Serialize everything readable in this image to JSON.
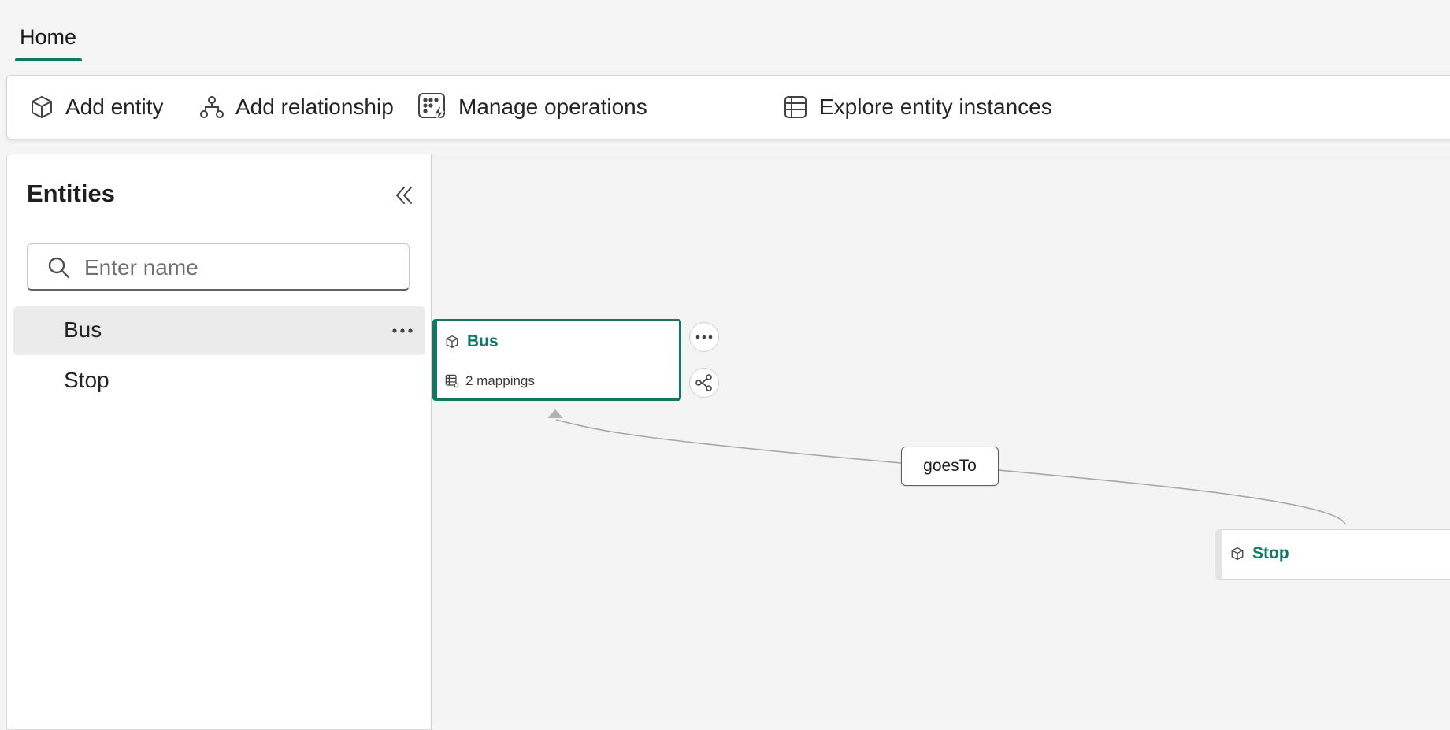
{
  "tabs": [
    {
      "label": "Home",
      "active": true
    }
  ],
  "ribbon": {
    "add_entity": "Add entity",
    "add_relationship": "Add relationship",
    "manage_operations": "Manage operations",
    "explore_instances": "Explore entity instances"
  },
  "entities_panel": {
    "title": "Entities",
    "search_placeholder": "Enter name",
    "items": [
      {
        "label": "Bus",
        "selected": true
      },
      {
        "label": "Stop",
        "selected": false
      }
    ]
  },
  "canvas": {
    "nodes": [
      {
        "name": "Bus",
        "subtitle": "2 mappings",
        "selected": true
      },
      {
        "name": "Stop"
      }
    ],
    "relationship": {
      "label": "goesTo"
    }
  },
  "colors": {
    "accent": "#117865",
    "background": "#f5f5f5",
    "edge": "#a8a8a8"
  },
  "icons": {
    "add_entity": "cube-icon",
    "add_relationship": "hierarchy-icon",
    "manage_operations": "grid-lightning-icon",
    "explore_instances": "table-icon",
    "collapse": "chevron-double-left-icon",
    "search": "search-icon",
    "more": "more-horizontal-icon"
  }
}
